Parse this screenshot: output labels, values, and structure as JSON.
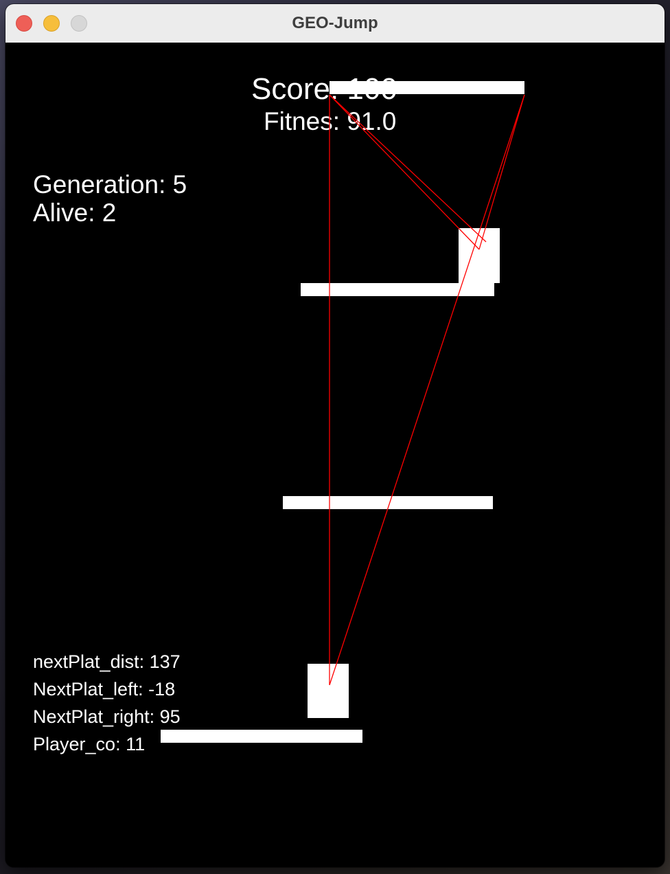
{
  "window": {
    "title": "GEO-Jump"
  },
  "hud": {
    "score": "Score: 100",
    "fitness": "Fitnes: 91.0",
    "generation": "Generation: 5",
    "alive": "Alive: 2"
  },
  "debug": {
    "next_plat_dist": "nextPlat_dist: 137",
    "next_plat_left": "NextPlat_left: -18",
    "next_plat_right": "NextPlat_right: 95",
    "player_co": "Player_co: 11"
  },
  "colors": {
    "background": "#000000",
    "platform": "#ffffff",
    "player": "#ffffff",
    "sensor_line": "#ff0000",
    "close_button": "#ee5f57",
    "minimize_button": "#f6be3b",
    "maximize_button": "#d7d7d7"
  }
}
